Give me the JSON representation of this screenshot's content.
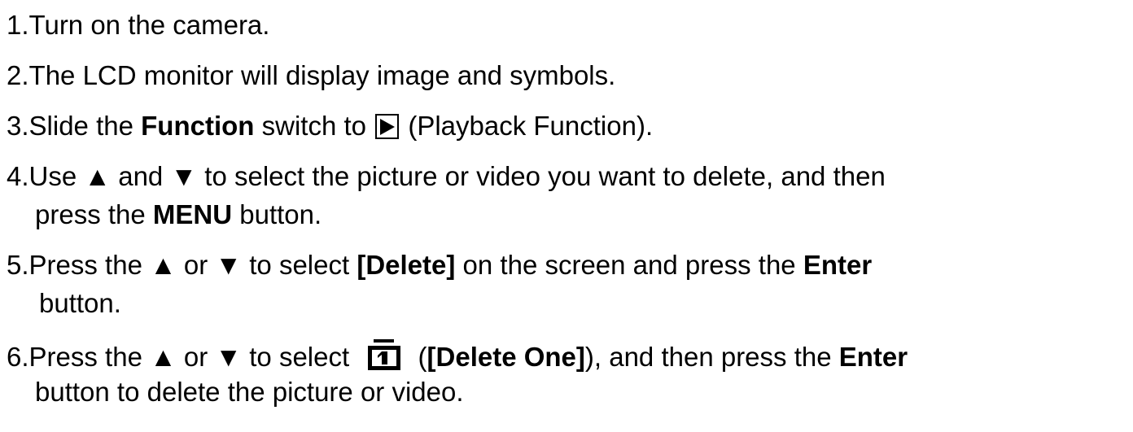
{
  "steps": [
    {
      "number": "1.",
      "text": "Turn on the camera."
    },
    {
      "number": "2.",
      "text": "The LCD monitor will display image and symbols."
    },
    {
      "number": "3.",
      "before": "Slide the ",
      "bold1": "Function",
      "after_bold1": " switch to ",
      "icon": "playback-icon",
      "after_icon": " (Playback Function)."
    },
    {
      "number": "4.",
      "line1": "Use ▲ and ▼ to select the picture or video you want to delete, and then",
      "line2_before": "press the ",
      "line2_bold": "MENU",
      "line2_after": " button."
    },
    {
      "number": "5.",
      "line1_before": "Press the ▲ or ▼ to select ",
      "line1_bold1": "[Delete]",
      "line1_mid": " on the screen and press the ",
      "line1_bold2": "Enter",
      "line2": "button."
    },
    {
      "number": "6.",
      "line1_before": "Press the ▲ or ▼ to select ",
      "icon": "delete-one-icon",
      "line1_paren_open": " (",
      "line1_bold1": "[Delete One]",
      "line1_mid": "), and then press the ",
      "line1_bold2": "Enter",
      "line2": "button to delete the picture or video."
    }
  ]
}
